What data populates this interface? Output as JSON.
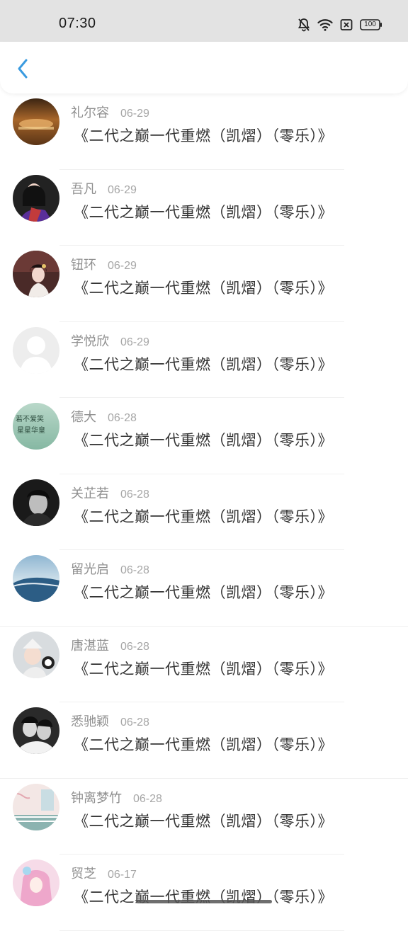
{
  "status_bar": {
    "time": "07:30",
    "battery": "100"
  },
  "header": {
    "back_icon": "chevron-left-icon",
    "accent": "#3a9be0"
  },
  "comments": [
    {
      "name": "礼尔容",
      "date": "06-29",
      "text": "《二代之巅一代重燃（凯熠）（零乐）》",
      "avatar": "photo"
    },
    {
      "name": "吾凡",
      "date": "06-29",
      "text": "《二代之巅一代重燃（凯熠）（零乐）》",
      "avatar": "photo"
    },
    {
      "name": "钮环",
      "date": "06-29",
      "text": "《二代之巅一代重燃（凯熠）（零乐）》",
      "avatar": "photo"
    },
    {
      "name": "学悦欣",
      "date": "06-29",
      "text": "《二代之巅一代重燃（凯熠）（零乐）》",
      "avatar": "default"
    },
    {
      "name": "德大",
      "date": "06-28",
      "text": "《二代之巅一代重燃（凯熠）（零乐）》",
      "avatar": "photo"
    },
    {
      "name": "关芷若",
      "date": "06-28",
      "text": "《二代之巅一代重燃（凯熠）（零乐）》",
      "avatar": "photo"
    },
    {
      "name": "留光启",
      "date": "06-28",
      "text": "《二代之巅一代重燃（凯熠）（零乐）》",
      "avatar": "photo"
    },
    {
      "name": "唐湛蓝",
      "date": "06-28",
      "text": "《二代之巅一代重燃（凯熠）（零乐）》",
      "avatar": "photo"
    },
    {
      "name": "悉驰颖",
      "date": "06-28",
      "text": "《二代之巅一代重燃（凯熠）（零乐）》",
      "avatar": "photo"
    },
    {
      "name": "钟离梦竹",
      "date": "06-28",
      "text": "《二代之巅一代重燃（凯熠）（零乐）》",
      "avatar": "photo"
    },
    {
      "name": "贸芝",
      "date": "06-17",
      "text": "《二代之巅一代重燃（凯熠）（零乐）》",
      "avatar": "photo"
    }
  ]
}
